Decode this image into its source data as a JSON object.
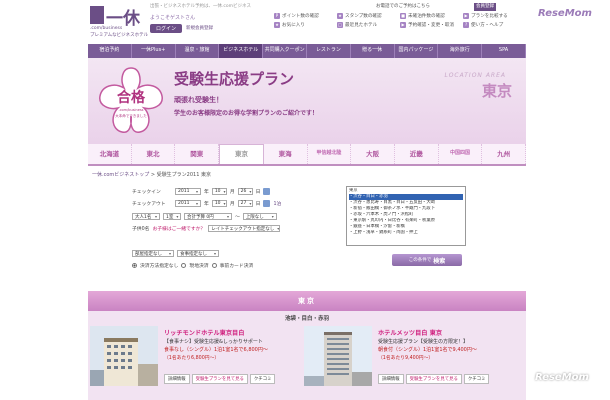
{
  "header": {
    "logo_kanji": "一休",
    "logo_sub1": ".com/business",
    "logo_sub2": "プレミアムなビジネスホテル",
    "breadcrumb_top": "出張・ビジネスホテル予約は、一休.comビジネス",
    "welcome": "ようこそゲストさん",
    "login_label": "ログイン",
    "register_link": "新規会員登録",
    "tel_text": "お電話でのご予約はこちら",
    "member_register": "会員登録",
    "site_badge": "ReseMom"
  },
  "toplinks": [
    {
      "icon": "P",
      "label": "ポイント数の確認"
    },
    {
      "icon": "★",
      "label": "スタンプ数の確認"
    },
    {
      "icon": "■",
      "label": "未確泊件数の確認"
    },
    {
      "icon": "▶",
      "label": "プランを比較する"
    },
    {
      "icon": "★",
      "label": "お気に入り"
    },
    {
      "icon": "□",
      "label": "最近見たホテル"
    },
    {
      "icon": "▶",
      "label": "予約確認・変更・取消"
    },
    {
      "icon": "?",
      "label": "使い方・ヘルプ"
    }
  ],
  "nav": [
    {
      "label": "宿泊予約",
      "active": false
    },
    {
      "label": "一休Plus+",
      "active": false
    },
    {
      "label": "温泉・旅館",
      "active": false
    },
    {
      "label": "ビジネスホテル",
      "active": true
    },
    {
      "label": "共同購入クーポン",
      "active": false
    },
    {
      "label": "レストラン",
      "active": false
    },
    {
      "label": "贈る一休",
      "active": false
    },
    {
      "label": "国内パッケージ",
      "active": false
    },
    {
      "label": "海外旅行",
      "active": false
    },
    {
      "label": "SPA",
      "active": false
    }
  ],
  "banner": {
    "seal_text": "合格",
    "seal_sub1": ".com/business",
    "seal_sub2": "大本命でできました",
    "title": "受験生応援プラン",
    "sub1": "頑張れ受験生！",
    "sub2": "学生のお客様限定のお得な学割プランのご紹介です！",
    "location_area_label": "LOCATION AREA",
    "location_area_value": "東京"
  },
  "areas": [
    {
      "label": "北海道",
      "active": false,
      "small": false
    },
    {
      "label": "東北",
      "active": false,
      "small": false
    },
    {
      "label": "関東",
      "active": false,
      "small": false
    },
    {
      "label": "東京",
      "active": true,
      "small": false
    },
    {
      "label": "東海",
      "active": false,
      "small": false
    },
    {
      "label": "甲信越北陸",
      "active": false,
      "small": true
    },
    {
      "label": "大阪",
      "active": false,
      "small": false
    },
    {
      "label": "近畿",
      "active": false,
      "small": false
    },
    {
      "label": "中国四国",
      "active": false,
      "small": true
    },
    {
      "label": "九州",
      "active": false,
      "small": false
    }
  ],
  "breadcrumb": {
    "root": "一休.comビジネストップ",
    "sep": ">",
    "mid": "受験生プラン2011 東京"
  },
  "search": {
    "checkin_label": "チェックイン",
    "checkin_year": "2011",
    "checkin_month": "10",
    "checkin_day": "26",
    "checkout_label": "チェックアウト",
    "checkout_year": "2011",
    "checkout_month": "10",
    "checkout_day": "27",
    "nights": "1泊",
    "adults": "大人1名",
    "rooms": "1室",
    "budget_min": "合計予算 0円",
    "budget_sep": "～",
    "budget_max": "上限なし",
    "children_label": "子供0名",
    "children_link": "お子様はご一緒ですか？",
    "late_checkout": "レイトチェックアウト指定なし",
    "room_type": "部屋指定なし",
    "meal": "食事指定なし",
    "payment_opts": [
      "決済方法指定なし",
      "現地決済",
      "事前カード決済"
    ],
    "area_list": [
      "東京",
      "・渋谷・目白・赤羽",
      "・渋谷・恵比寿・目黒・目白・五反田・大崎",
      "・新宿・飯田橋・御茶ノ水・半蔵門・九段下",
      "・赤坂・六本木・虎ノ門・浜松町",
      "・東京駅・丸の内・日比谷・有楽町・秋葉原",
      "・銀座・日本橋・汐留・新橋",
      "・上野・浅草・錦糸町・両国・押上"
    ],
    "area_list_highlight": 1,
    "go_label": "この条件で",
    "go_bold": "検索"
  },
  "section": {
    "title": "東京",
    "subarea": "池袋・目白・赤羽"
  },
  "hotels": [
    {
      "name": "リッチモンドホテル東京目白",
      "desc": "【食事ナシ】受験生応援&しっかりサポート",
      "price1": "食事なし（シングル）1泊1室1名で6,800円～",
      "price2": "（1名あたり6,800円～）",
      "btns": [
        "詳細情報",
        "受験生プランを見て見る",
        "クチコミ"
      ]
    },
    {
      "name": "ホテルメッツ目白 東京",
      "desc": "受験生応援プラン【受験生の方限定！】",
      "price1": "朝食付（シングル）1泊1室1名で9,400円～",
      "price2": "（1名あたり9,400円～）",
      "btns": [
        "詳細情報",
        "受験生プランを見て見る",
        "クチコミ"
      ]
    }
  ],
  "colors": {
    "purple": "#7a5c97",
    "pink": "#c983c2",
    "banner_bg": "#ead2ea",
    "hotel_title": "#d0207f"
  }
}
